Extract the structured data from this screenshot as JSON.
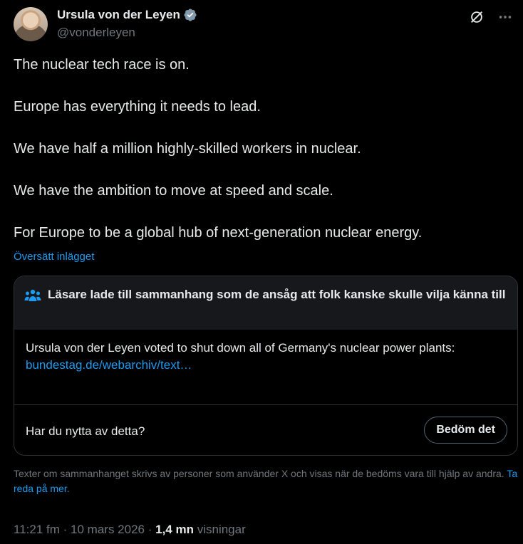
{
  "author": {
    "name": "Ursula von der Leyen",
    "handle": "@vonderleyen",
    "verified": true
  },
  "icons": {
    "verified": "verified-badge-icon",
    "grok": "grok-icon",
    "more": "more-options-icon",
    "community": "people-icon"
  },
  "colors": {
    "accent": "#1d9bf0",
    "background": "#000000",
    "muted": "#71767b",
    "note_header_bg": "#16181c"
  },
  "tweet": {
    "paragraphs": [
      "The nuclear tech race is on.",
      "Europe has everything it needs to lead.",
      "We have half a million highly-skilled workers in nuclear.",
      "We have the ambition to move at speed and scale.",
      "For Europe to be a global hub of next-generation nuclear energy."
    ],
    "translate_label": "Översätt inlägget"
  },
  "community_note": {
    "header": "Läsare lade till sammanhang som de ansåg att folk kanske skulle vilja känna till",
    "body": "Ursula von der Leyen voted to shut down all of Germany's nuclear power plants:",
    "link": "bundestag.de/webarchiv/text…",
    "helpful_question": "Har du nytta av detta?",
    "rate_button": "Bedöm det"
  },
  "disclaimer": {
    "text": "Texter om sammanhanget skrivs av personer som använder X och visas när de bedöms vara till hjälp av andra.",
    "link": "Ta reda på mer."
  },
  "meta": {
    "time": "11:21 fm",
    "separator": "·",
    "date": "10 mars 2026",
    "views_count": "1,4 mn",
    "views_label": "visningar"
  }
}
